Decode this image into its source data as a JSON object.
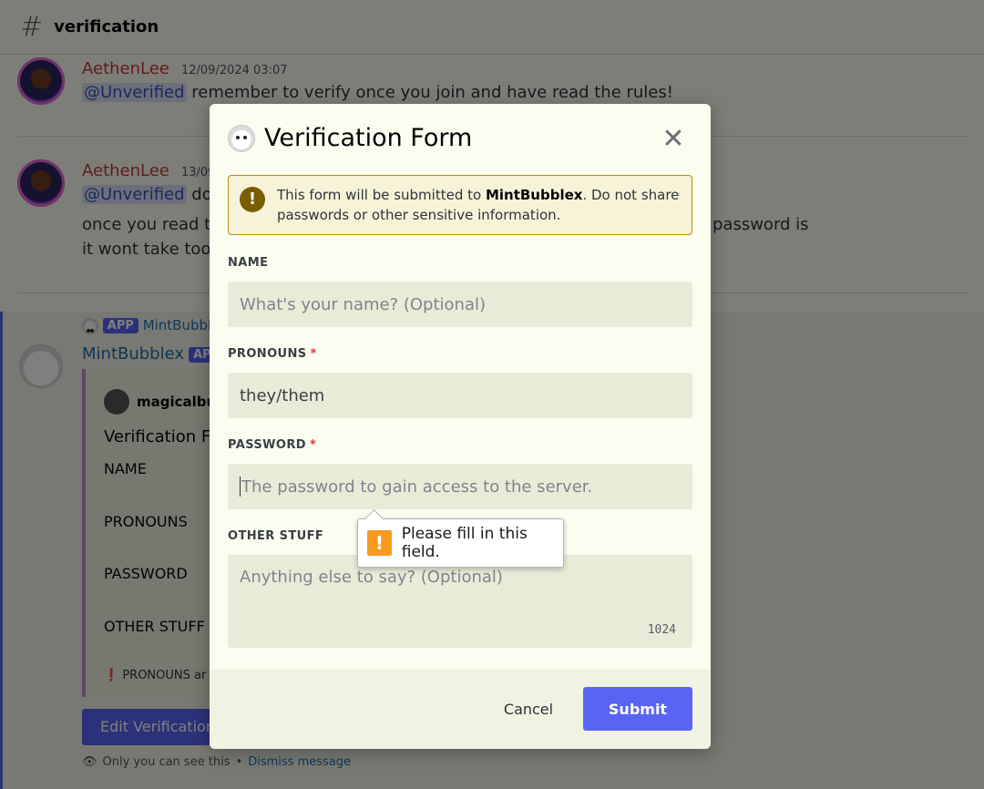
{
  "channel": {
    "name": "verification"
  },
  "messages": [
    {
      "author": "AethenLee",
      "timestamp": "12/09/2024 03:07",
      "mention": "@Unverified",
      "text": "remember to verify once you join and have read the rules!"
    },
    {
      "author": "AethenLee",
      "timestamp": "13/09",
      "mention": "@Unverified",
      "text": "do",
      "line2": "once you read th",
      "line2_tail": "password is",
      "line3": "it wont take too"
    }
  ],
  "app_message": {
    "reply_name": "MintBubbl",
    "app_badge": "APP",
    "author": "MintBubblex",
    "author_badge": "AP",
    "embed_author": "magicalbu",
    "embed_title": "Verification Fo",
    "fields": [
      "NAME",
      "PRONOUNS",
      "PASSWORD",
      "OTHER STUFF"
    ],
    "warning": "PRONOUNS ar",
    "edit_button": "Edit Verification",
    "only_you": "Only you can see this",
    "separator": "•",
    "dismiss": "Dismiss message"
  },
  "modal": {
    "title": "Verification Form",
    "close_icon": "close-icon",
    "warning": {
      "prefix": "This form will be submitted to ",
      "bot": "MintBubblex",
      "suffix": ". Do not share passwords or other sensitive information."
    },
    "fields": [
      {
        "label": "NAME",
        "required": false,
        "placeholder": "What's your name? (Optional)",
        "value": ""
      },
      {
        "label": "PRONOUNS",
        "required": true,
        "placeholder": "",
        "value": "they/them"
      },
      {
        "label": "PASSWORD",
        "required": true,
        "placeholder": "The password to gain access to the server.",
        "value": ""
      },
      {
        "label": "OTHER STUFF",
        "required": false,
        "placeholder": "Anything else to say? (Optional)",
        "value": "",
        "counter": "1024"
      }
    ],
    "required_mark": "*",
    "tooltip": "Please fill in this field.",
    "tooltip_icon": "!",
    "cancel": "Cancel",
    "submit": "Submit"
  }
}
